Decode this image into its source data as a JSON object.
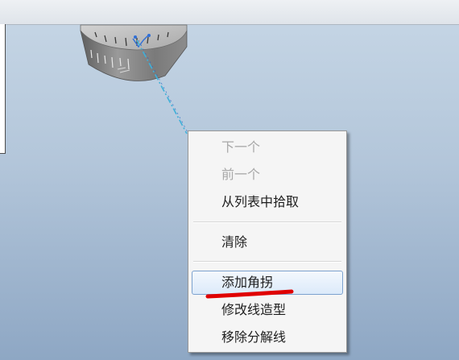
{
  "context_menu": {
    "items": [
      {
        "label": "下一个",
        "enabled": false
      },
      {
        "label": "前一个",
        "enabled": false
      },
      {
        "label": "从列表中拾取",
        "enabled": true
      },
      {
        "label": "清除",
        "enabled": true
      },
      {
        "label": "添加角拐",
        "enabled": true,
        "hovered": true
      },
      {
        "label": "修改线造型",
        "enabled": true
      },
      {
        "label": "移除分解线",
        "enabled": true
      }
    ]
  },
  "colors": {
    "highlight_border": "#7da2ce",
    "annotation_underline": "#e00000",
    "explode_line": "#3fb0d8"
  },
  "icons": {
    "model": "dial-part-model",
    "annotation": "red-underline-mark"
  }
}
